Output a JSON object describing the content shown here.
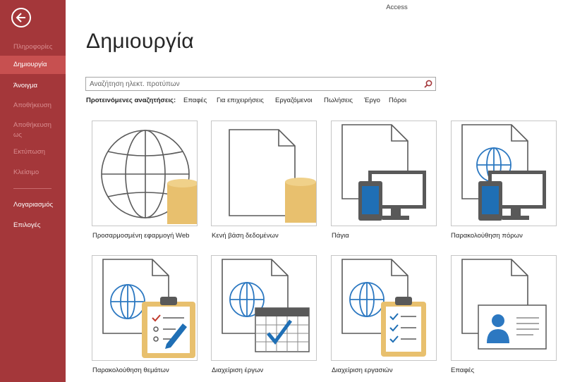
{
  "window": {
    "app_title": "Access"
  },
  "sidebar": {
    "items": [
      {
        "label": "Πληροφορίες",
        "state": "disabled"
      },
      {
        "label": "Δημιουργία",
        "state": "selected"
      },
      {
        "label": "Άνοιγμα",
        "state": "normal"
      },
      {
        "label": "Αποθήκευση",
        "state": "disabled"
      },
      {
        "label": "Αποθήκευση ως",
        "state": "disabled"
      },
      {
        "label": "Εκτύπωση",
        "state": "disabled"
      },
      {
        "label": "Κλείσιμο",
        "state": "disabled"
      },
      {
        "label": "Λογαριασμός",
        "state": "normal"
      },
      {
        "label": "Επιλογές",
        "state": "normal"
      }
    ]
  },
  "main": {
    "title": "Δημιουργία",
    "search": {
      "placeholder": "Αναζήτηση ηλεκτ. προτύπων"
    },
    "suggested": {
      "label": "Προτεινόμενες αναζητήσεις:",
      "items": [
        "Επαφές",
        "Για επιχειρήσεις",
        "Εργαζόμενοι",
        "Πωλήσεις",
        "Έργο",
        "Πόροι"
      ]
    },
    "templates": [
      {
        "label": "Προσαρμοσμένη εφαρμογή Web",
        "icon": "globe-database-icon"
      },
      {
        "label": "Κενή βάση δεδομένων",
        "icon": "document-database-icon"
      },
      {
        "label": "Πάγια",
        "icon": "document-devices-icon"
      },
      {
        "label": "Παρακολούθηση πόρων",
        "icon": "globe-devices-icon"
      },
      {
        "label": "Παρακολούθηση θεμάτων",
        "icon": "globe-clipboard-icon"
      },
      {
        "label": "Διαχείριση έργων",
        "icon": "globe-calendar-icon"
      },
      {
        "label": "Διαχείριση εργασιών",
        "icon": "globe-checklist-icon"
      },
      {
        "label": "Επαφές",
        "icon": "contact-card-icon"
      }
    ]
  },
  "colors": {
    "accent": "#a4373a",
    "selected": "#c75050",
    "database": "#e8c06e",
    "device": "#1f6fb5",
    "globe": "#2c78c1"
  }
}
